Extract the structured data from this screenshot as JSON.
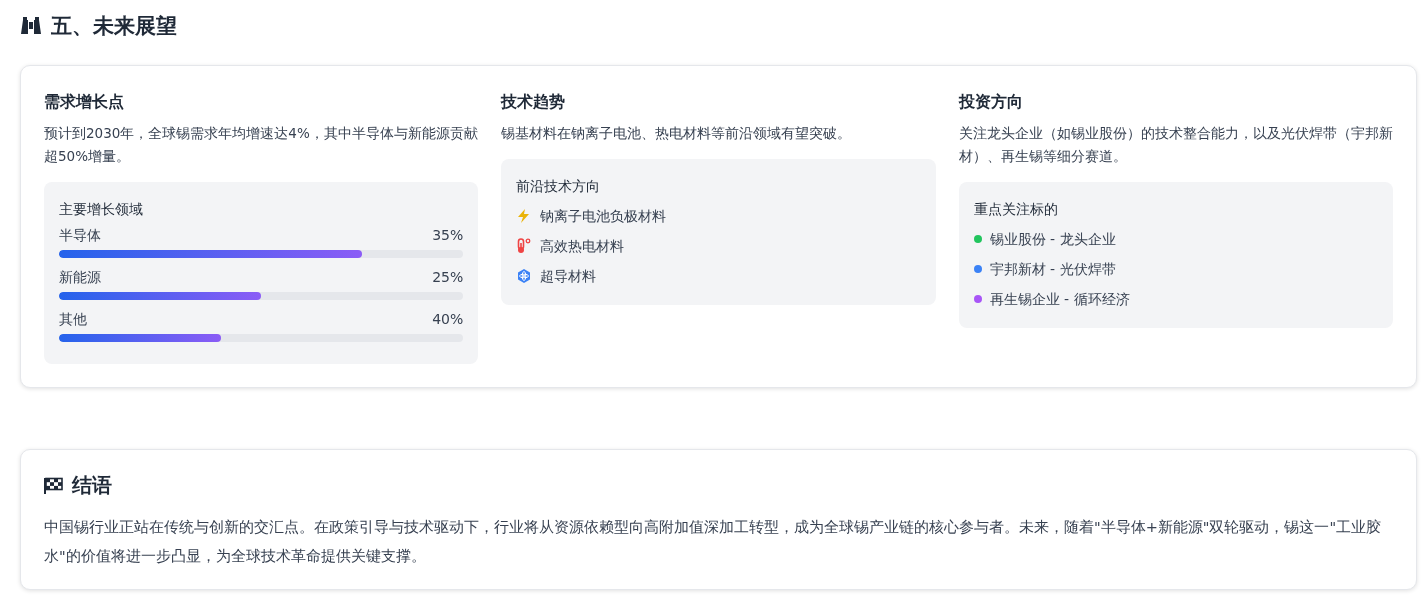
{
  "section_title": "五、未来展望",
  "columns": [
    {
      "kind": "bars",
      "heading": "需求增长点",
      "text": "预计到2030年，全球锡需求年均增速达4%，其中半导体与新能源贡献超50%增量。",
      "panel_title": "主要增长领域",
      "items": [
        {
          "label": "半导体",
          "value": "35%",
          "level": 0.75
        },
        {
          "label": "新能源",
          "value": "25%",
          "level": 0.5
        },
        {
          "label": "其他",
          "value": "40%",
          "level": 0.4
        }
      ]
    },
    {
      "kind": "icons",
      "heading": "技术趋势",
      "text": "锡基材料在钠离子电池、热电材料等前沿领域有望突破。",
      "panel_title": "前沿技术方向",
      "items": [
        {
          "label": "钠离子电池负极材料"
        },
        {
          "label": "高效热电材料"
        },
        {
          "label": "超导材料"
        }
      ]
    },
    {
      "kind": "dots",
      "heading": "投资方向",
      "text": "关注龙头企业（如锡业股份）的技术整合能力，以及光伏焊带（宇邦新材）、再生锡等细分赛道。",
      "panel_title": "重点关注标的",
      "items": [
        {
          "color": "#22c55e",
          "label": "锡业股份 - 龙头企业"
        },
        {
          "color": "#3b82f6",
          "label": "宇邦新材 - 光伏焊带"
        },
        {
          "color": "#a855f7",
          "label": "再生锡企业 - 循环经济"
        }
      ]
    }
  ],
  "conclusion": {
    "title": "结语",
    "text": "中国锡行业正站在传统与创新的交汇点。在政策引导与技术驱动下，行业将从资源依赖型向高附加值深加工转型，成为全球锡产业链的核心参与者。未来，随着\"半导体+新能源\"双轮驱动，锡这一\"工业胶水\"的价值将进一步凸显，为全球技术革命提供关键支撑。"
  }
}
